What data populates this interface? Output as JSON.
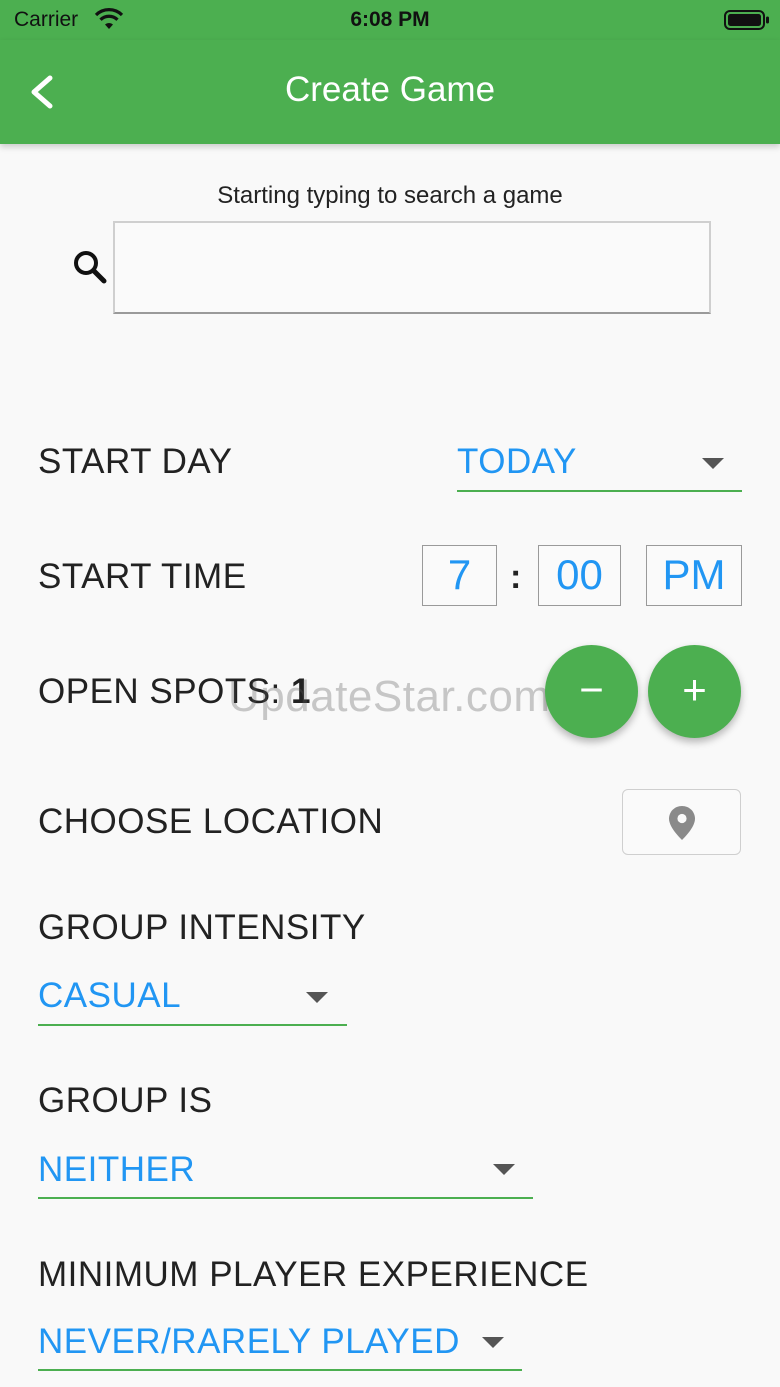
{
  "status_bar": {
    "carrier": "Carrier",
    "time": "6:08 PM"
  },
  "app_bar": {
    "title": "Create Game",
    "back_icon": "chevron-left-icon"
  },
  "search": {
    "hint": "Starting typing to search a game",
    "value": "",
    "icon": "search-icon"
  },
  "start_day": {
    "label": "START DAY",
    "value": "TODAY"
  },
  "start_time": {
    "label": "START TIME",
    "hour": "7",
    "separator": ":",
    "minute": "00",
    "period": "PM"
  },
  "open_spots": {
    "label": "OPEN SPOTS:",
    "value": "1",
    "decrement_label": "−",
    "increment_label": "+"
  },
  "location": {
    "label": "CHOOSE LOCATION",
    "icon": "map-pin-icon"
  },
  "group_intensity": {
    "label": "GROUP INTENSITY",
    "value": "CASUAL"
  },
  "group_is": {
    "label": "GROUP IS",
    "value": "NEITHER"
  },
  "min_experience": {
    "label": "MINIMUM PLAYER EXPERIENCE",
    "value": "NEVER/RARELY PLAYED"
  },
  "watermark": "UpdateStar.com",
  "colors": {
    "primary": "#4caf50",
    "value_text": "#2196f3",
    "background": "#f9f9f9"
  }
}
